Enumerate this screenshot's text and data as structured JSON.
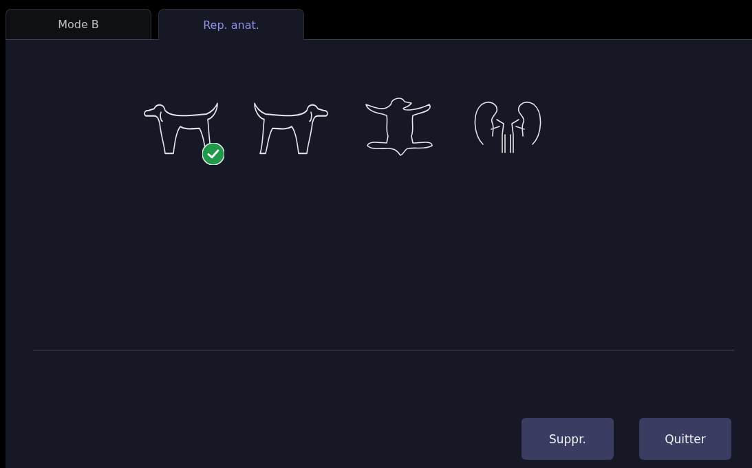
{
  "tabs": [
    {
      "label": "Mode B",
      "selected": false
    },
    {
      "label": "Rep. anat.",
      "selected": true
    }
  ],
  "body_markers": [
    {
      "kind": "dog-left",
      "selected": true
    },
    {
      "kind": "dog-right",
      "selected": false
    },
    {
      "kind": "dog-supine",
      "selected": false
    },
    {
      "kind": "kidneys",
      "selected": false
    }
  ],
  "buttons": [
    "Suppr.",
    "Quitter"
  ]
}
